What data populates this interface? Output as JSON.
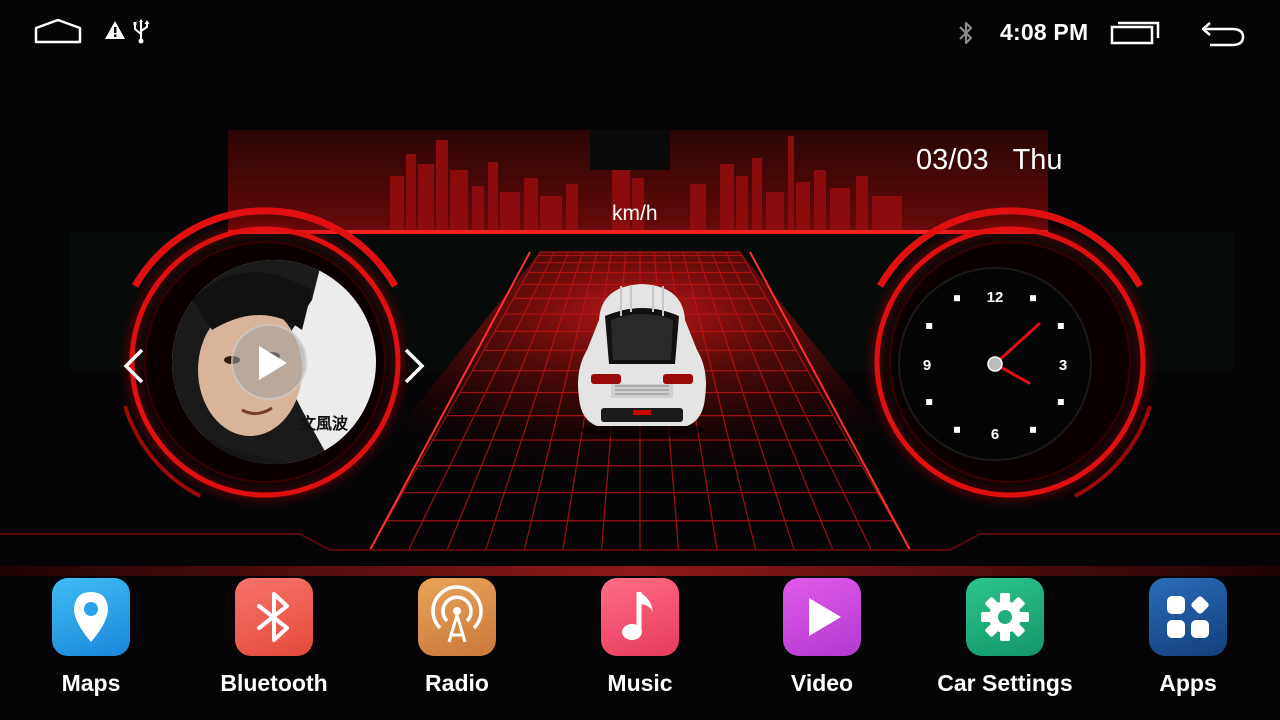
{
  "status_bar": {
    "time": "4:08 PM",
    "icons": [
      "home-icon",
      "alert-icon",
      "usb-icon",
      "bluetooth-icon",
      "recents-icon",
      "back-icon"
    ]
  },
  "dashboard": {
    "date": "03/03",
    "weekday": "Thu",
    "speed_unit": "km/h",
    "album_art_text": "文風波",
    "clock": {
      "numerals": [
        "12",
        "3",
        "6",
        "9"
      ],
      "hour_hand_color": "#e01010",
      "minute_hand_color": "#e01010"
    }
  },
  "dock": {
    "apps": [
      {
        "label": "Maps",
        "icon": "map-pin-icon",
        "color": "#2aa4ec"
      },
      {
        "label": "Bluetooth",
        "icon": "bluetooth-icon",
        "color": "#f05a4a"
      },
      {
        "label": "Radio",
        "icon": "radio-antenna-icon",
        "color": "#d98f4a"
      },
      {
        "label": "Music",
        "icon": "music-note-icon",
        "color": "#f24e6e"
      },
      {
        "label": "Video",
        "icon": "play-icon",
        "color": "#c64ad8"
      },
      {
        "label": "Car Settings",
        "icon": "gear-icon",
        "color": "#1fae7a"
      },
      {
        "label": "Apps",
        "icon": "grid-icon",
        "color": "#1e5aa0"
      }
    ]
  },
  "colors": {
    "accent": "#e01010",
    "background": "#050507"
  }
}
